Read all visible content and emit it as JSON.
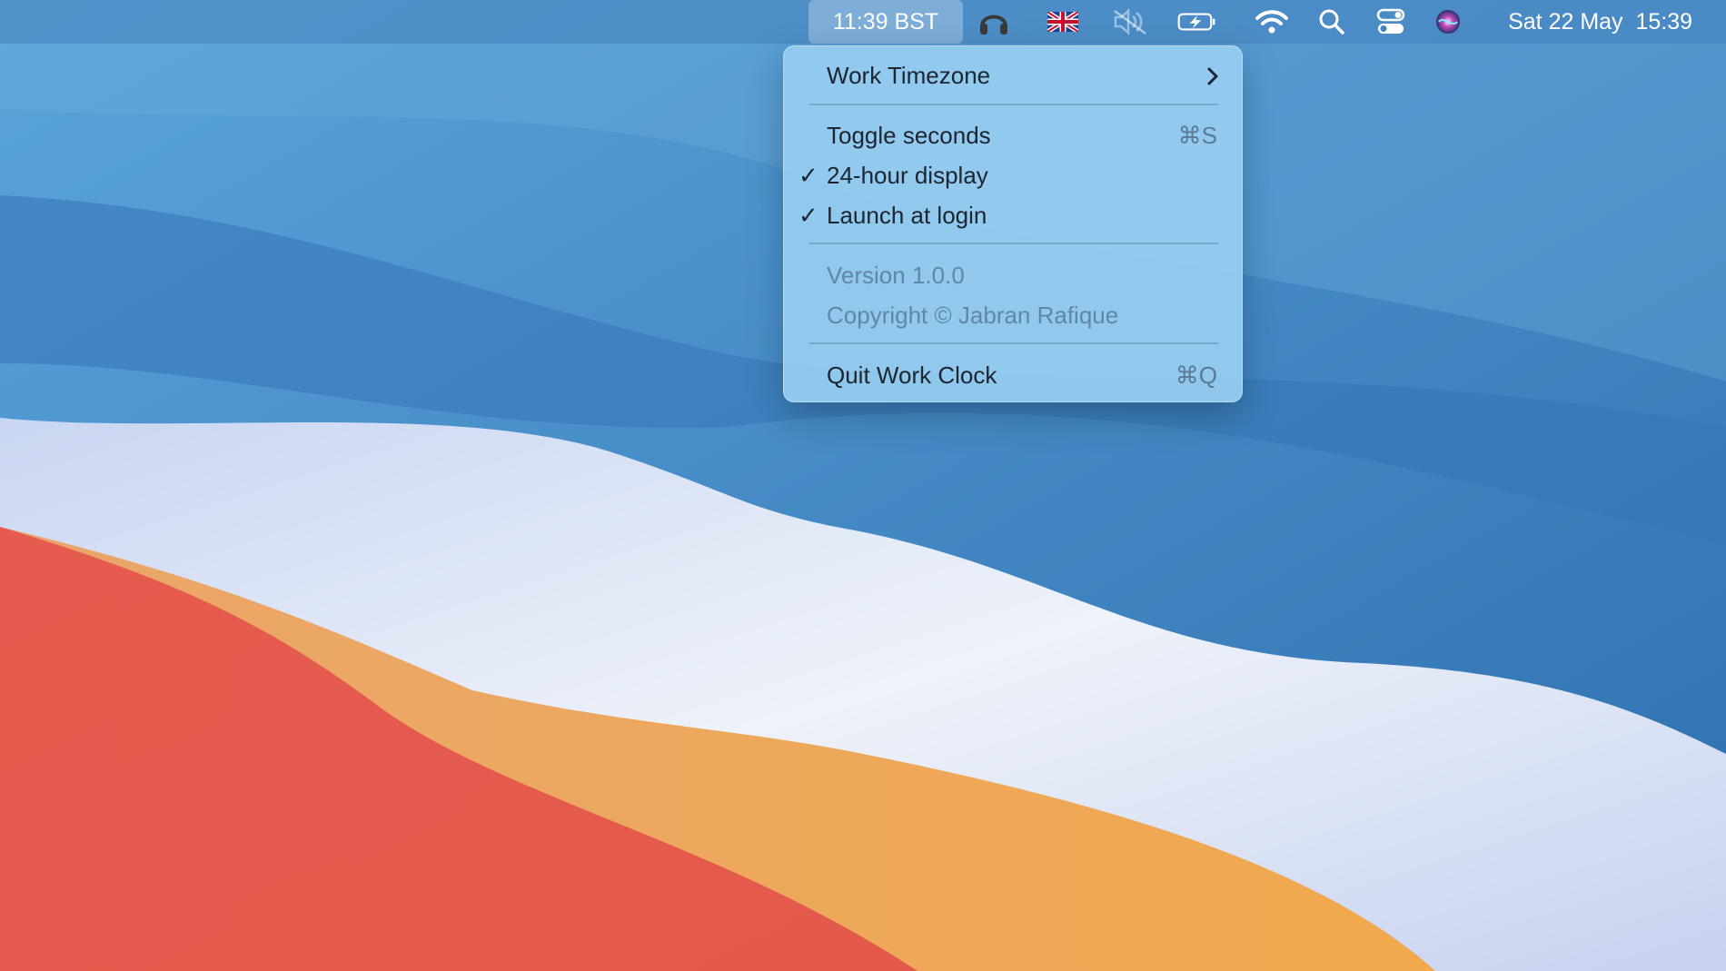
{
  "menubar": {
    "clock_label": "11:39 BST",
    "datetime": "Sat 22 May  15:39",
    "icons": [
      "headphones-icon",
      "uk-flag-icon",
      "speaker-muted-icon",
      "battery-charging-icon",
      "wifi-icon",
      "search-icon",
      "control-center-icon",
      "siri-icon"
    ]
  },
  "menu": {
    "items": [
      {
        "label": "Work Timezone",
        "has_submenu": true
      },
      {
        "label": "Toggle seconds",
        "shortcut": "⌘S"
      },
      {
        "label": "24-hour display",
        "checked": true
      },
      {
        "label": "Launch at login",
        "checked": true
      },
      {
        "label": "Version 1.0.0",
        "disabled": true
      },
      {
        "label": "Copyright © Jabran Rafique",
        "disabled": true
      },
      {
        "label": "Quit Work Clock",
        "shortcut": "⌘Q"
      }
    ],
    "check_mark": "✓"
  },
  "colors": {
    "menubar_bg": "#4682be",
    "menu_bg": "#96cdf0",
    "wallpaper_blue": "#3f86c7",
    "wallpaper_red": "#e65b4f",
    "wallpaper_orange": "#efa64f",
    "wallpaper_white": "#e8eef7"
  }
}
